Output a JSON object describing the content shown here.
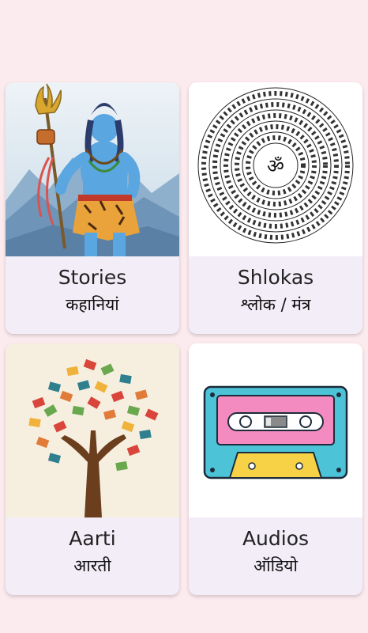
{
  "cards": [
    {
      "title": "Stories",
      "subtitle": "कहानियां",
      "image": "shiva-illustration"
    },
    {
      "title": "Shlokas",
      "subtitle": "श्लोक / मंत्र",
      "image": "om-mantra-spiral"
    },
    {
      "title": "Aarti",
      "subtitle": "आरती",
      "image": "book-tree"
    },
    {
      "title": "Audios",
      "subtitle": "ऑडियो",
      "image": "cassette-tape"
    }
  ],
  "colors": {
    "background": "#fcebee",
    "card": "#f3edf8",
    "cassette_body": "#4dc3d8",
    "cassette_label": "#f38bc0",
    "cassette_bottom": "#f7d146"
  }
}
